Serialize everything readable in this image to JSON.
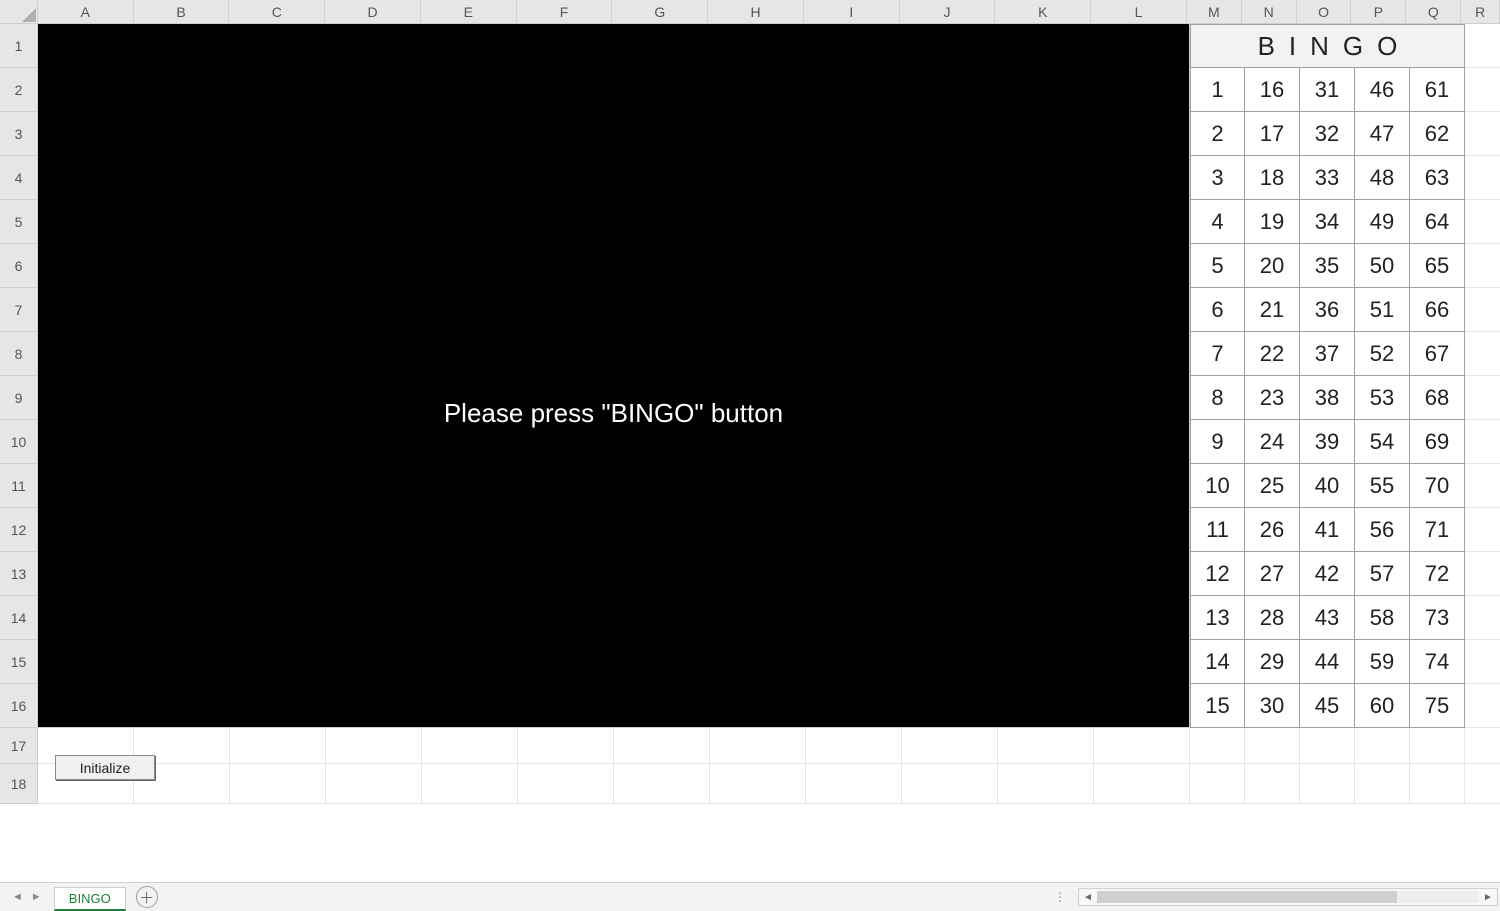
{
  "columns": [
    "A",
    "B",
    "C",
    "D",
    "E",
    "F",
    "G",
    "H",
    "I",
    "J",
    "K",
    "L",
    "M",
    "N",
    "O",
    "P",
    "Q",
    "R"
  ],
  "column_widths": {
    "A": 96,
    "B": 96,
    "C": 96,
    "D": 96,
    "E": 96,
    "F": 96,
    "G": 96,
    "H": 96,
    "I": 96,
    "J": 96,
    "K": 96,
    "L": 96,
    "M": 55,
    "N": 55,
    "O": 55,
    "P": 55,
    "Q": 55,
    "R": 39
  },
  "rows": [
    1,
    2,
    3,
    4,
    5,
    6,
    7,
    8,
    9,
    10,
    11,
    12,
    13,
    14,
    15,
    16,
    17,
    18
  ],
  "row_heights": {
    "1": 44,
    "2": 44,
    "3": 44,
    "4": 44,
    "5": 44,
    "6": 44,
    "7": 44,
    "8": 44,
    "9": 44,
    "10": 44,
    "11": 44,
    "12": 44,
    "13": 44,
    "14": 44,
    "15": 44,
    "16": 44,
    "17": 36,
    "18": 40
  },
  "black_block": {
    "message": "Please press \"BINGO\" button"
  },
  "bingo": {
    "header": "BINGO",
    "columns": {
      "B": [
        1,
        2,
        3,
        4,
        5,
        6,
        7,
        8,
        9,
        10,
        11,
        12,
        13,
        14,
        15
      ],
      "I": [
        16,
        17,
        18,
        19,
        20,
        21,
        22,
        23,
        24,
        25,
        26,
        27,
        28,
        29,
        30
      ],
      "N": [
        31,
        32,
        33,
        34,
        35,
        36,
        37,
        38,
        39,
        40,
        41,
        42,
        43,
        44,
        45
      ],
      "G": [
        46,
        47,
        48,
        49,
        50,
        51,
        52,
        53,
        54,
        55,
        56,
        57,
        58,
        59,
        60
      ],
      "O": [
        61,
        62,
        63,
        64,
        65,
        66,
        67,
        68,
        69,
        70,
        71,
        72,
        73,
        74,
        75
      ]
    }
  },
  "buttons": {
    "initialize": "Initialize"
  },
  "tabs": {
    "active": "BINGO"
  }
}
